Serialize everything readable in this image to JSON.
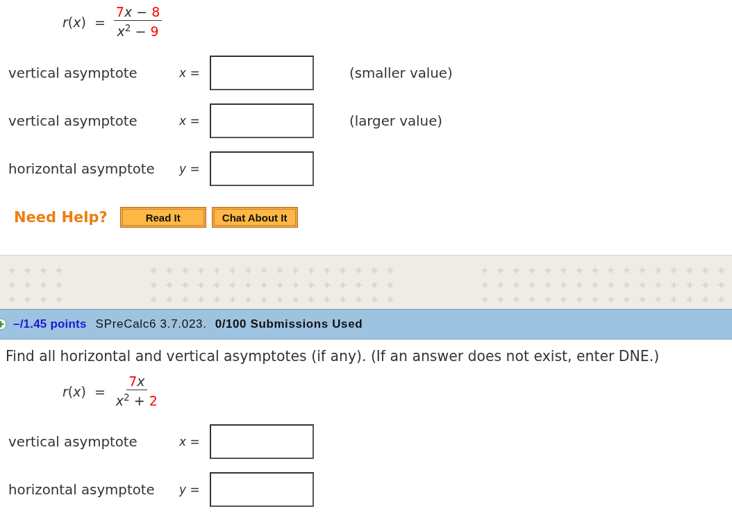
{
  "question_1": {
    "formula": {
      "function": "*r*(*x*)",
      "equals": "=",
      "numerator": [
        {
          "text": "7",
          "color": "#ff0000"
        },
        {
          "text": "*x* − ",
          "color": "#333333"
        },
        {
          "text": "8",
          "color": "#ff0000"
        }
      ],
      "denominator": [
        {
          "text": "*x*$^{2}$ − ",
          "color": "#333333"
        },
        {
          "text": "9",
          "color": "#ff0000"
        }
      ]
    },
    "answers": [
      {
        "label": "vertical asymptote",
        "variable": "*x* =",
        "note": "(smaller value)"
      },
      {
        "label": "vertical asymptote",
        "variable": "*x* =",
        "note": "(larger value)"
      },
      {
        "label": "horizontal asymptote",
        "variable": "*y* ="
      }
    ],
    "help": {
      "label": "Need Help?",
      "buttons": [
        "Read It",
        "Chat About It"
      ]
    }
  },
  "header": {
    "points": "–/1.45 points",
    "source": "SPreCalc6 3.7.023.",
    "submissions": "0/100 Submissions Used"
  },
  "question_2": {
    "prompt": "Find all horizontal and vertical asymptotes (if any). (If an answer does not exist, enter DNE.)",
    "formula": {
      "function": "*r*(*x*)",
      "equals": "=",
      "numerator": [
        {
          "text": "7",
          "color": "#ff0000"
        },
        {
          "text": "*x*",
          "color": "#333333"
        }
      ],
      "denominator": [
        {
          "text": "*x*$^{2}$ + ",
          "color": "#333333"
        },
        {
          "text": "2",
          "color": "#ff0000"
        }
      ]
    },
    "answers": [
      {
        "label": "vertical asymptote",
        "variable": "*x* ="
      },
      {
        "label": "horizontal asymptote",
        "variable": "*y* ="
      }
    ]
  }
}
